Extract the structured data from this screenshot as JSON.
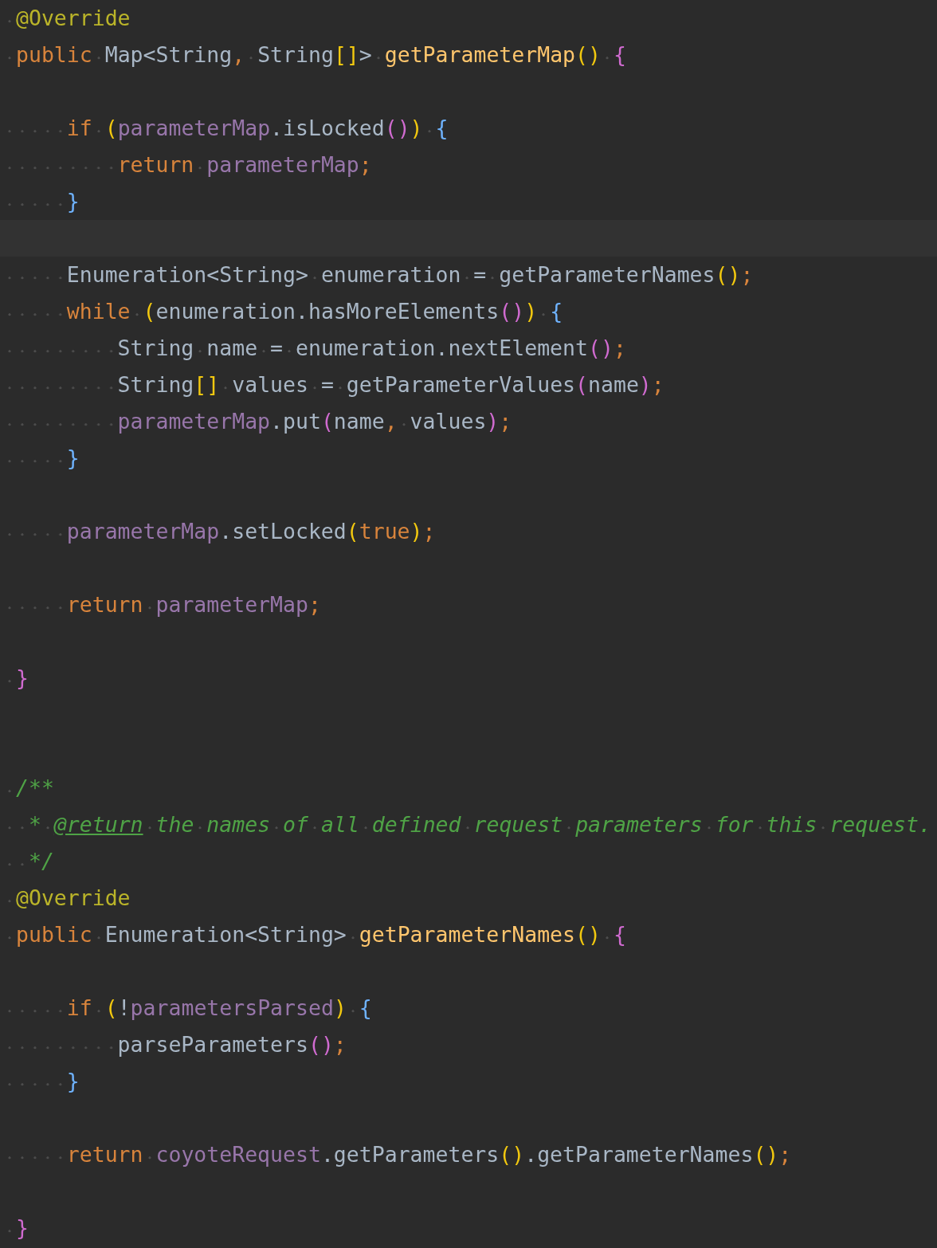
{
  "editor": {
    "lines": [
      {
        "current": false,
        "tokens": [
          {
            "text": " @Override",
            "kind": "annotation"
          }
        ]
      },
      {
        "current": false,
        "tokens": [
          {
            "text": " public",
            "kind": "keyword"
          },
          {
            "text": " Map<String",
            "kind": "plain"
          },
          {
            "text": ",",
            "kind": "punct"
          },
          {
            "text": " String",
            "kind": "plain"
          },
          {
            "text": "[]",
            "kind": "bracket",
            "color": "#f2c80f"
          },
          {
            "text": ">",
            "kind": "plain"
          },
          {
            "text": " getParameterMap",
            "kind": "method"
          },
          {
            "text": "()",
            "kind": "bracket",
            "color": "#f2c80f"
          },
          {
            "text": " {",
            "kind": "bracket",
            "color": "#d06bd0"
          }
        ]
      },
      {
        "current": false
      },
      {
        "current": false,
        "tokens": [
          {
            "text": "     if",
            "kind": "keyword"
          },
          {
            "text": " (",
            "kind": "bracket",
            "color": "#f2c80f"
          },
          {
            "text": "parameterMap",
            "kind": "field"
          },
          {
            "text": ".isLocked",
            "kind": "plain"
          },
          {
            "text": "()",
            "kind": "bracket",
            "color": "#d06bd0"
          },
          {
            "text": ")",
            "kind": "bracket",
            "color": "#f2c80f"
          },
          {
            "text": " {",
            "kind": "bracket",
            "color": "#6fb3ff"
          }
        ]
      },
      {
        "current": false,
        "tokens": [
          {
            "text": "         return",
            "kind": "keyword"
          },
          {
            "text": " parameterMap",
            "kind": "field"
          },
          {
            "text": ";",
            "kind": "punct"
          }
        ]
      },
      {
        "current": false,
        "tokens": [
          {
            "text": "     }",
            "kind": "bracket",
            "color": "#6fb3ff"
          }
        ]
      },
      {
        "current": true
      },
      {
        "current": false,
        "tokens": [
          {
            "text": "     Enumeration<String> enumeration = getParameterNames",
            "kind": "plain"
          },
          {
            "text": "()",
            "kind": "bracket",
            "color": "#f2c80f"
          },
          {
            "text": ";",
            "kind": "punct"
          }
        ]
      },
      {
        "current": false,
        "tokens": [
          {
            "text": "     while",
            "kind": "keyword"
          },
          {
            "text": " (",
            "kind": "bracket",
            "color": "#f2c80f"
          },
          {
            "text": "enumeration.hasMoreElements",
            "kind": "plain"
          },
          {
            "text": "()",
            "kind": "bracket",
            "color": "#d06bd0"
          },
          {
            "text": ")",
            "kind": "bracket",
            "color": "#f2c80f"
          },
          {
            "text": " {",
            "kind": "bracket",
            "color": "#6fb3ff"
          }
        ]
      },
      {
        "current": false,
        "tokens": [
          {
            "text": "         String name = enumeration.nextElement",
            "kind": "plain"
          },
          {
            "text": "()",
            "kind": "bracket",
            "color": "#d06bd0"
          },
          {
            "text": ";",
            "kind": "punct"
          }
        ]
      },
      {
        "current": false,
        "tokens": [
          {
            "text": "         String",
            "kind": "plain"
          },
          {
            "text": "[]",
            "kind": "bracket",
            "color": "#f2c80f"
          },
          {
            "text": " values = getParameterValues",
            "kind": "plain"
          },
          {
            "text": "(",
            "kind": "bracket",
            "color": "#d06bd0"
          },
          {
            "text": "name",
            "kind": "plain"
          },
          {
            "text": ")",
            "kind": "bracket",
            "color": "#d06bd0"
          },
          {
            "text": ";",
            "kind": "punct"
          }
        ]
      },
      {
        "current": false,
        "tokens": [
          {
            "text": "         parameterMap",
            "kind": "field"
          },
          {
            "text": ".put",
            "kind": "plain"
          },
          {
            "text": "(",
            "kind": "bracket",
            "color": "#d06bd0"
          },
          {
            "text": "name",
            "kind": "plain"
          },
          {
            "text": ",",
            "kind": "punct"
          },
          {
            "text": " values",
            "kind": "plain"
          },
          {
            "text": ")",
            "kind": "bracket",
            "color": "#d06bd0"
          },
          {
            "text": ";",
            "kind": "punct"
          }
        ]
      },
      {
        "current": false,
        "tokens": [
          {
            "text": "     }",
            "kind": "bracket",
            "color": "#6fb3ff"
          }
        ]
      },
      {
        "current": false
      },
      {
        "current": false,
        "tokens": [
          {
            "text": "     parameterMap",
            "kind": "field"
          },
          {
            "text": ".setLocked",
            "kind": "plain"
          },
          {
            "text": "(",
            "kind": "bracket",
            "color": "#f2c80f"
          },
          {
            "text": "true",
            "kind": "keyword"
          },
          {
            "text": ")",
            "kind": "bracket",
            "color": "#f2c80f"
          },
          {
            "text": ";",
            "kind": "punct"
          }
        ]
      },
      {
        "current": false
      },
      {
        "current": false,
        "tokens": [
          {
            "text": "     return",
            "kind": "keyword"
          },
          {
            "text": " parameterMap",
            "kind": "field"
          },
          {
            "text": ";",
            "kind": "punct"
          }
        ]
      },
      {
        "current": false
      },
      {
        "current": false,
        "tokens": [
          {
            "text": " }",
            "kind": "bracket",
            "color": "#d06bd0"
          }
        ]
      },
      {
        "current": false
      },
      {
        "current": false
      },
      {
        "current": false,
        "tokens": [
          {
            "text": " /**",
            "kind": "comment"
          }
        ]
      },
      {
        "current": false,
        "tokens": [
          {
            "text": "  *",
            "kind": "comment"
          },
          {
            "text": " @return",
            "kind": "doc_tag"
          },
          {
            "text": " the names of all defined request parameters for this request.",
            "kind": "comment"
          }
        ]
      },
      {
        "current": false,
        "tokens": [
          {
            "text": "  */",
            "kind": "comment"
          }
        ]
      },
      {
        "current": false,
        "tokens": [
          {
            "text": " @Override",
            "kind": "annotation"
          }
        ]
      },
      {
        "current": false,
        "tokens": [
          {
            "text": " public",
            "kind": "keyword"
          },
          {
            "text": " Enumeration<String>",
            "kind": "plain"
          },
          {
            "text": " getParameterNames",
            "kind": "method"
          },
          {
            "text": "()",
            "kind": "bracket",
            "color": "#f2c80f"
          },
          {
            "text": " {",
            "kind": "bracket",
            "color": "#d06bd0"
          }
        ]
      },
      {
        "current": false
      },
      {
        "current": false,
        "tokens": [
          {
            "text": "     if",
            "kind": "keyword"
          },
          {
            "text": " (",
            "kind": "bracket",
            "color": "#f2c80f"
          },
          {
            "text": "!",
            "kind": "plain"
          },
          {
            "text": "parametersParsed",
            "kind": "field"
          },
          {
            "text": ")",
            "kind": "bracket",
            "color": "#f2c80f"
          },
          {
            "text": " {",
            "kind": "bracket",
            "color": "#6fb3ff"
          }
        ]
      },
      {
        "current": false,
        "tokens": [
          {
            "text": "         parseParameters",
            "kind": "plain"
          },
          {
            "text": "()",
            "kind": "bracket",
            "color": "#d06bd0"
          },
          {
            "text": ";",
            "kind": "punct"
          }
        ]
      },
      {
        "current": false,
        "tokens": [
          {
            "text": "     }",
            "kind": "bracket",
            "color": "#6fb3ff"
          }
        ]
      },
      {
        "current": false
      },
      {
        "current": false,
        "tokens": [
          {
            "text": "     return",
            "kind": "keyword"
          },
          {
            "text": " coyoteRequest",
            "kind": "field"
          },
          {
            "text": ".getParameters",
            "kind": "plain"
          },
          {
            "text": "()",
            "kind": "bracket",
            "color": "#f2c80f"
          },
          {
            "text": ".getParameterNames",
            "kind": "plain"
          },
          {
            "text": "()",
            "kind": "bracket",
            "color": "#f2c80f"
          },
          {
            "text": ";",
            "kind": "punct"
          }
        ]
      },
      {
        "current": false
      },
      {
        "current": false,
        "tokens": [
          {
            "text": " }",
            "kind": "bracket",
            "color": "#d06bd0"
          }
        ]
      }
    ]
  }
}
